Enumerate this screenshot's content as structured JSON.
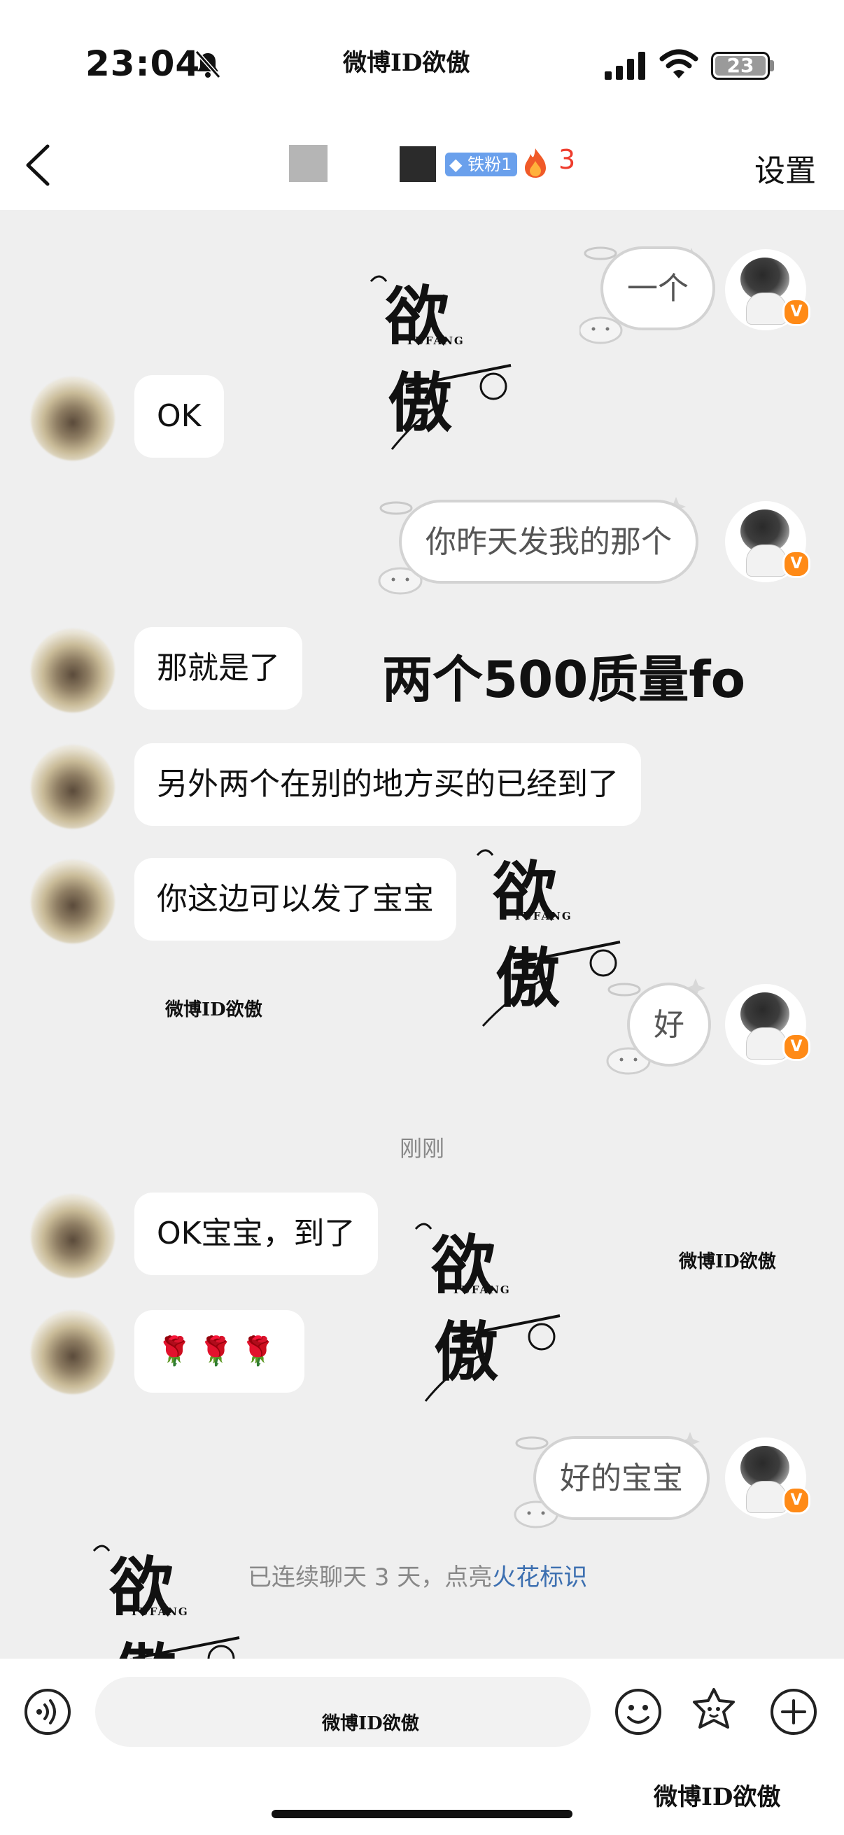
{
  "status": {
    "time": "23:04",
    "watermark": "微博ID欲傲",
    "battery": "23"
  },
  "header": {
    "fan_badge": "铁粉1",
    "fire_count": "3",
    "settings": "设置"
  },
  "messages": {
    "m1": "一个",
    "m2": "OK",
    "m3": "你昨天发我的那个",
    "m4": "那就是了",
    "m5": "另外两个在别的地方买的已经到了",
    "m6": "你这边可以发了宝宝",
    "m7": "好",
    "m8": "OK宝宝，到了",
    "m9": "🌹🌹🌹",
    "m10": "好的宝宝"
  },
  "timestamp": "刚刚",
  "overlay_text": "两个500质量fo",
  "watermarks": {
    "small": "微博ID欲傲",
    "logo_top": "欲",
    "logo_bottom": "傲",
    "logo_latin": "YUFANG"
  },
  "system_note": {
    "prefix": "已连续聊天 3 天，点亮",
    "link": "火花标识"
  },
  "input": {
    "watermark": "微博ID欲傲"
  },
  "footer_watermark": "微博ID欲傲",
  "colors": {
    "fire": "#ee3c2d",
    "link": "#3c6fb0",
    "verified": "#ff8a16",
    "fan_badge": "#6aa0ec"
  }
}
